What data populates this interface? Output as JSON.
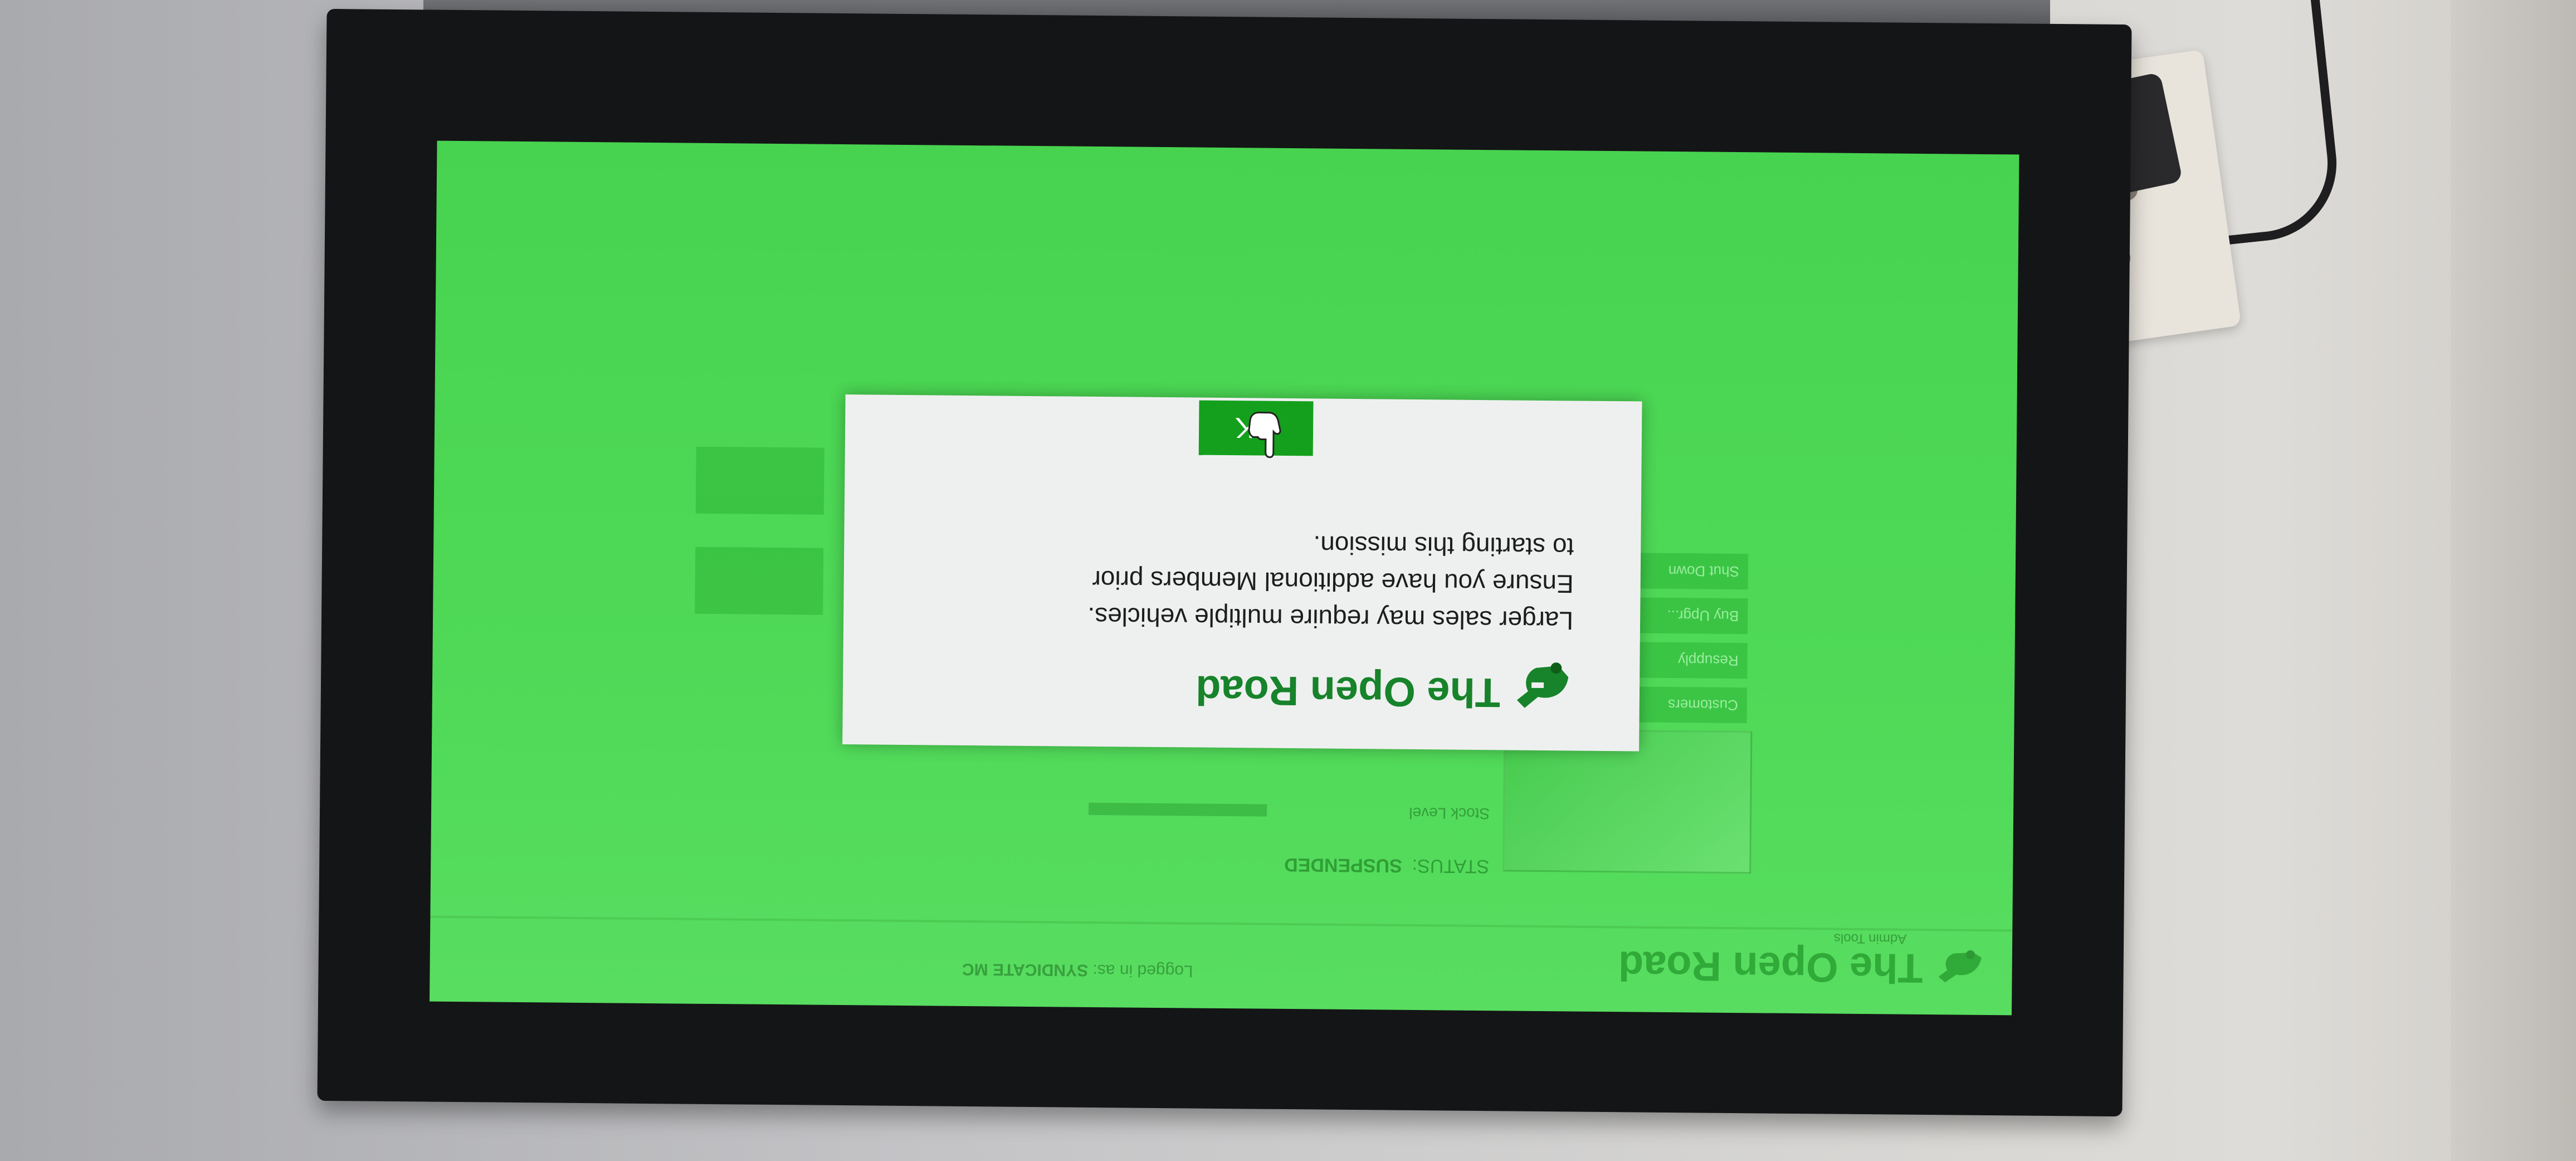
{
  "app": {
    "title_part1": "The Open",
    "title_part2": "Road",
    "subtitle": "Admin Tools",
    "logged_in_label": "Logged in as:",
    "logged_in_user": "SYNDICATE MC"
  },
  "mission": {
    "status_label": "STATUS:",
    "status_value": "SUSPENDED",
    "stock_label": "Stock Level",
    "side_buttons": [
      "Customers",
      "Resupply",
      "Buy Upgr...",
      "Shut Down"
    ]
  },
  "dialog": {
    "title_part1": "The Open",
    "title_part2": "Road",
    "message_lines": [
      "Larger sales may require multiple vehicles.",
      "Ensure you have additional Members prior",
      "to starting this mission."
    ],
    "ok_label": "OK"
  },
  "colors": {
    "screen_green": "#4fd957",
    "brand_green": "#17832a",
    "button_green": "#14a01c",
    "dialog_bg": "#eef0ef"
  },
  "icons": {
    "logo": "open-road-hand-logo-icon",
    "cursor": "hand-pointer-icon"
  }
}
